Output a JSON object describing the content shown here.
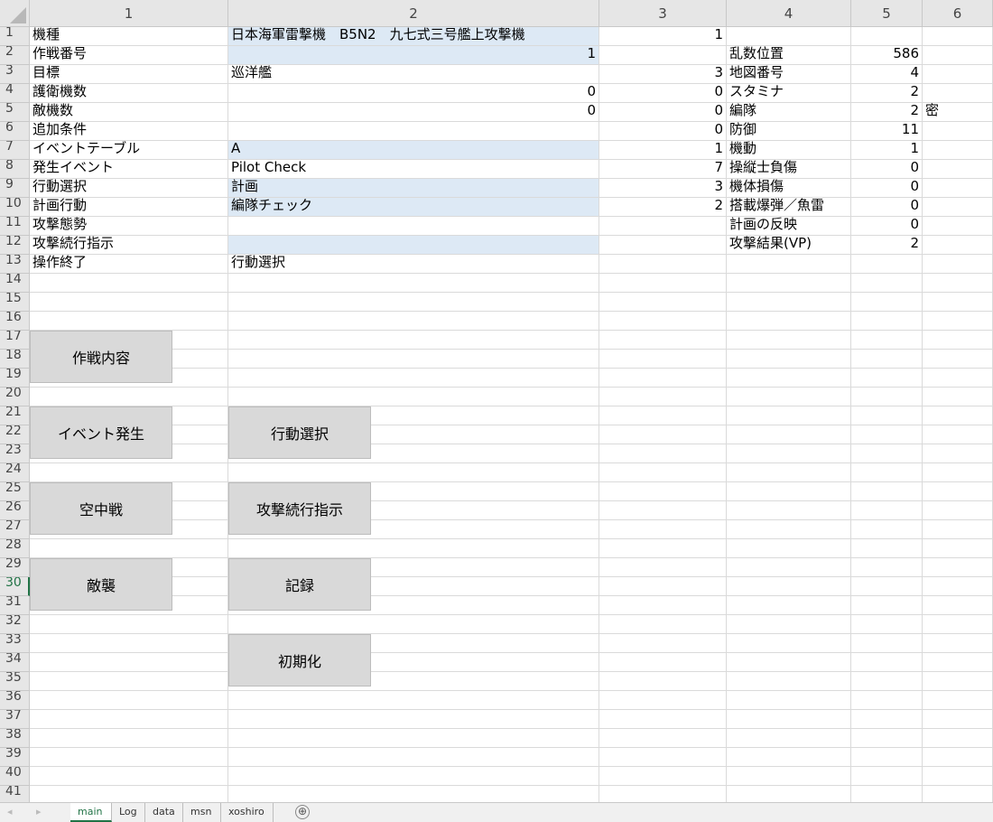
{
  "columns": [
    "1",
    "2",
    "3",
    "4",
    "5",
    "6"
  ],
  "rows": [
    "1",
    "2",
    "3",
    "4",
    "5",
    "6",
    "7",
    "8",
    "9",
    "10",
    "11",
    "12",
    "13",
    "14",
    "15",
    "16",
    "17",
    "18",
    "19",
    "20",
    "21",
    "22",
    "23",
    "24",
    "25",
    "26",
    "27",
    "28",
    "29",
    "30",
    "31",
    "32",
    "33",
    "34",
    "35",
    "36",
    "37",
    "38",
    "39",
    "40",
    "41"
  ],
  "selected_row": "30",
  "cells": [
    {
      "row": 1,
      "col": 1,
      "text": "機種"
    },
    {
      "row": 1,
      "col": 2,
      "text": "日本海軍雷撃機　B5N2　九七式三号艦上攻撃機",
      "fill": true
    },
    {
      "row": 1,
      "col": 3,
      "text": "1",
      "num": true
    },
    {
      "row": 2,
      "col": 1,
      "text": "作戦番号"
    },
    {
      "row": 2,
      "col": 2,
      "text": "1",
      "fill": true,
      "num": true
    },
    {
      "row": 2,
      "col": 4,
      "text": "乱数位置"
    },
    {
      "row": 2,
      "col": 5,
      "text": "586",
      "num": true
    },
    {
      "row": 3,
      "col": 1,
      "text": "目標"
    },
    {
      "row": 3,
      "col": 2,
      "text": "巡洋艦"
    },
    {
      "row": 3,
      "col": 3,
      "text": "3",
      "num": true
    },
    {
      "row": 3,
      "col": 4,
      "text": "地図番号"
    },
    {
      "row": 3,
      "col": 5,
      "text": "4",
      "num": true
    },
    {
      "row": 4,
      "col": 1,
      "text": "護衛機数"
    },
    {
      "row": 4,
      "col": 2,
      "text": "0",
      "num": true
    },
    {
      "row": 4,
      "col": 3,
      "text": "0",
      "num": true
    },
    {
      "row": 4,
      "col": 4,
      "text": "スタミナ"
    },
    {
      "row": 4,
      "col": 5,
      "text": "2",
      "num": true
    },
    {
      "row": 5,
      "col": 1,
      "text": "敵機数"
    },
    {
      "row": 5,
      "col": 2,
      "text": "0",
      "num": true
    },
    {
      "row": 5,
      "col": 3,
      "text": "0",
      "num": true
    },
    {
      "row": 5,
      "col": 4,
      "text": "編隊"
    },
    {
      "row": 5,
      "col": 5,
      "text": "2",
      "num": true
    },
    {
      "row": 5,
      "col": 6,
      "text": "密"
    },
    {
      "row": 6,
      "col": 1,
      "text": "追加条件"
    },
    {
      "row": 6,
      "col": 3,
      "text": "0",
      "num": true
    },
    {
      "row": 6,
      "col": 4,
      "text": "防御"
    },
    {
      "row": 6,
      "col": 5,
      "text": "11",
      "num": true
    },
    {
      "row": 7,
      "col": 1,
      "text": "イベントテーブル"
    },
    {
      "row": 7,
      "col": 2,
      "text": "A",
      "fill": true
    },
    {
      "row": 7,
      "col": 3,
      "text": "1",
      "num": true
    },
    {
      "row": 7,
      "col": 4,
      "text": "機動"
    },
    {
      "row": 7,
      "col": 5,
      "text": "1",
      "num": true
    },
    {
      "row": 8,
      "col": 1,
      "text": "発生イベント"
    },
    {
      "row": 8,
      "col": 2,
      "text": "Pilot Check"
    },
    {
      "row": 8,
      "col": 3,
      "text": "7",
      "num": true
    },
    {
      "row": 8,
      "col": 4,
      "text": "操縦士負傷"
    },
    {
      "row": 8,
      "col": 5,
      "text": "0",
      "num": true
    },
    {
      "row": 9,
      "col": 1,
      "text": "行動選択"
    },
    {
      "row": 9,
      "col": 2,
      "text": "計画",
      "fill": true
    },
    {
      "row": 9,
      "col": 3,
      "text": "3",
      "num": true
    },
    {
      "row": 9,
      "col": 4,
      "text": "機体損傷"
    },
    {
      "row": 9,
      "col": 5,
      "text": "0",
      "num": true
    },
    {
      "row": 10,
      "col": 1,
      "text": "計画行動"
    },
    {
      "row": 10,
      "col": 2,
      "text": "編隊チェック",
      "fill": true
    },
    {
      "row": 10,
      "col": 3,
      "text": "2",
      "num": true
    },
    {
      "row": 10,
      "col": 4,
      "text": "搭載爆弾／魚雷"
    },
    {
      "row": 10,
      "col": 5,
      "text": "0",
      "num": true
    },
    {
      "row": 11,
      "col": 1,
      "text": "攻撃態勢"
    },
    {
      "row": 11,
      "col": 4,
      "text": "計画の反映"
    },
    {
      "row": 11,
      "col": 5,
      "text": "0",
      "num": true
    },
    {
      "row": 12,
      "col": 1,
      "text": "攻撃続行指示"
    },
    {
      "row": 12,
      "col": 2,
      "text": "",
      "fill": true
    },
    {
      "row": 12,
      "col": 4,
      "text": "攻撃結果(VP)"
    },
    {
      "row": 12,
      "col": 5,
      "text": "2",
      "num": true
    },
    {
      "row": 13,
      "col": 1,
      "text": "操作終了"
    },
    {
      "row": 13,
      "col": 2,
      "text": "行動選択"
    }
  ],
  "buttons": [
    {
      "id": "mission",
      "label": "作戦内容"
    },
    {
      "id": "event",
      "label": "イベント発生"
    },
    {
      "id": "action",
      "label": "行動選択"
    },
    {
      "id": "aircombat",
      "label": "空中戦"
    },
    {
      "id": "continue",
      "label": "攻撃続行指示"
    },
    {
      "id": "raid",
      "label": "敵襲"
    },
    {
      "id": "record",
      "label": "記録"
    },
    {
      "id": "reset",
      "label": "初期化"
    }
  ],
  "tabs": [
    {
      "label": "main",
      "active": true
    },
    {
      "label": "Log"
    },
    {
      "label": "data"
    },
    {
      "label": "msn"
    },
    {
      "label": "xoshiro"
    }
  ],
  "add_tab_glyph": "⊕",
  "nav_prev_glyph": "◂",
  "nav_next_glyph": "▸",
  "colors": {
    "accent": "#217346",
    "cell_fill": "#dde9f5",
    "button_bg": "#d9d9d9"
  }
}
